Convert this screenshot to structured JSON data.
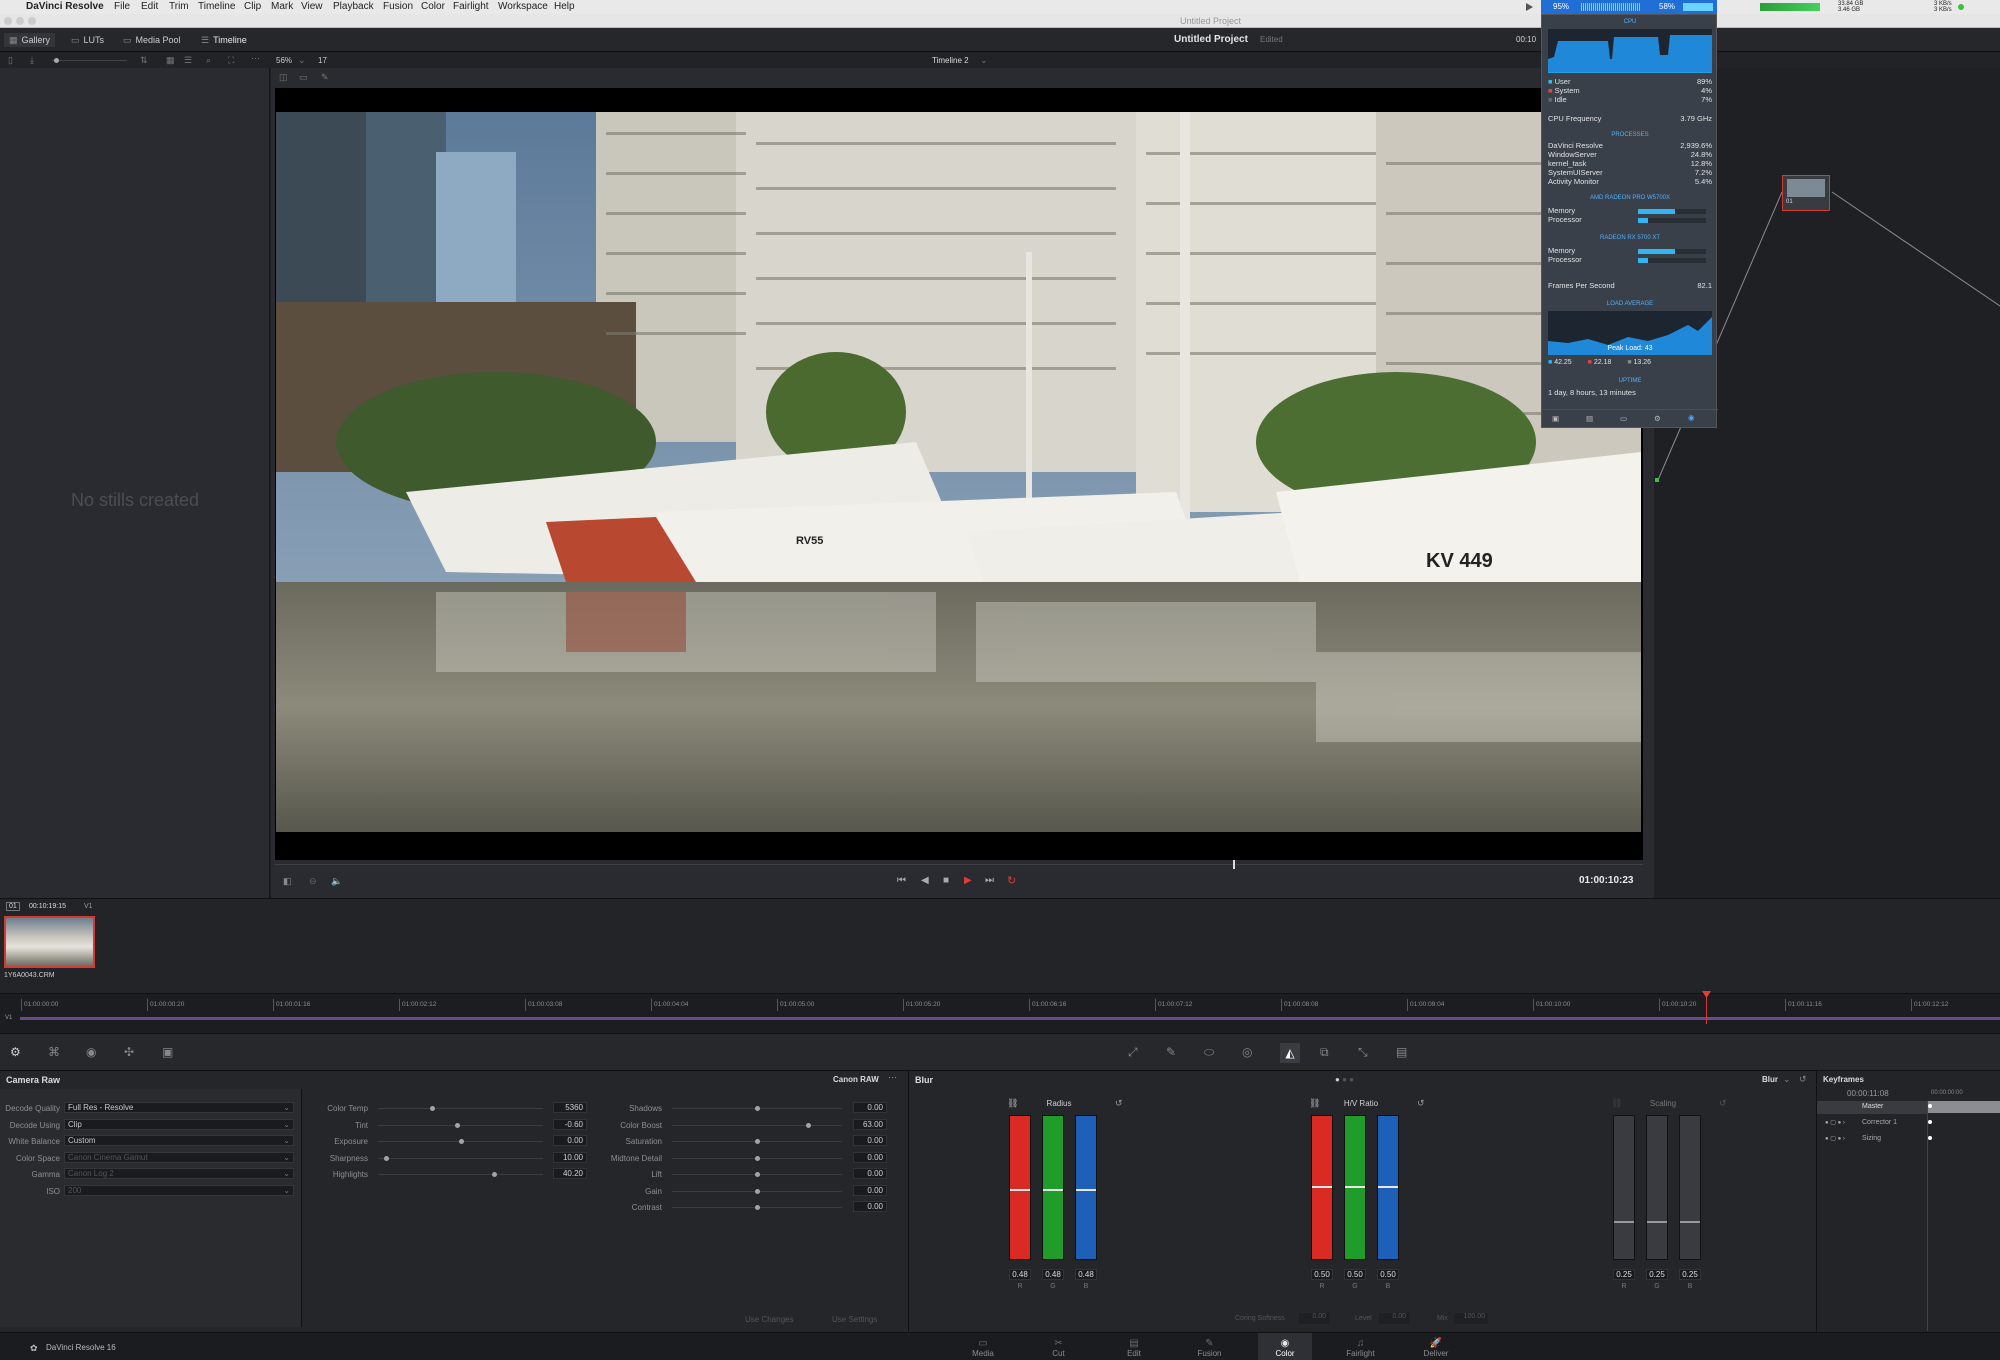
{
  "menubar": {
    "apple": "",
    "items": [
      "DaVinci Resolve",
      "File",
      "Edit",
      "Trim",
      "Timeline",
      "Clip",
      "Mark",
      "View",
      "Playback",
      "Fusion",
      "Color",
      "Fairlight",
      "Workspace",
      "Help"
    ],
    "status": {
      "cpu_pct": "95%",
      "gpu_pct": "58%",
      "net_up": "33.84 GB",
      "net_down": "3.46 GB",
      "rate_up": "3 KB/s",
      "rate_down": "3 KB/s"
    }
  },
  "window": {
    "title": "Untitled Project"
  },
  "pagebar": {
    "gallery": "Gallery",
    "luts": "LUTs",
    "media_pool": "Media Pool",
    "timeline": "Timeline",
    "project_title": "Untitled Project",
    "project_status": "Edited",
    "timecode_cut": "00:10"
  },
  "viewer": {
    "zoom": "56%",
    "frame_count": "17",
    "timeline_name": "Timeline 2",
    "timecode": "01:00:10:23",
    "image_label_a": "KV 449",
    "image_label_b": "RV55",
    "playhead_fraction": 0.7
  },
  "gallery": {
    "empty": "No stills created"
  },
  "clips": {
    "index": "01",
    "timecode": "00:10:19:15",
    "track": "V1",
    "clip_name": "1Y6A0043.CRM"
  },
  "ruler": {
    "track": "V1",
    "ticks": [
      "01:00:00:00",
      "01:00:00:20",
      "01:00:01:16",
      "01:00:02:12",
      "01:00:03:08",
      "01:00:04:04",
      "01:00:05:00",
      "01:00:05:20",
      "01:00:06:16",
      "01:00:07:12",
      "01:00:08:08",
      "01:00:09:04",
      "01:00:10:00",
      "01:00:10:20",
      "01:00:11:16",
      "01:00:12:12"
    ],
    "playhead_fraction": 0.853
  },
  "camera_raw": {
    "title": "Camera Raw",
    "codec": "Canon RAW",
    "left": [
      {
        "label": "Decode Quality",
        "value": "Full Res - Resolve",
        "disabled": false
      },
      {
        "label": "Decode Using",
        "value": "Clip",
        "disabled": false
      },
      {
        "label": "White Balance",
        "value": "Custom",
        "disabled": false
      },
      {
        "label": "Color Space",
        "value": "Canon Cinema Gamut",
        "disabled": true
      },
      {
        "label": "Gamma",
        "value": "Canon Log 2",
        "disabled": true
      },
      {
        "label": "ISO",
        "value": "200",
        "disabled": true
      }
    ],
    "mid": [
      {
        "label": "Color Temp",
        "value": "5360",
        "pos": 0.33
      },
      {
        "label": "Tint",
        "value": "-0.60",
        "pos": 0.48
      },
      {
        "label": "Exposure",
        "value": "0.00",
        "pos": 0.5
      },
      {
        "label": "Sharpness",
        "value": "10.00",
        "pos": 0.05
      },
      {
        "label": "Highlights",
        "value": "40.20",
        "pos": 0.7
      }
    ],
    "right": [
      {
        "label": "Shadows",
        "value": "0.00",
        "pos": 0.5
      },
      {
        "label": "Color Boost",
        "value": "63.00",
        "pos": 0.8
      },
      {
        "label": "Saturation",
        "value": "0.00",
        "pos": 0.5
      },
      {
        "label": "Midtone Detail",
        "value": "0.00",
        "pos": 0.5
      },
      {
        "label": "Lift",
        "value": "0.00",
        "pos": 0.5
      },
      {
        "label": "Gain",
        "value": "0.00",
        "pos": 0.5
      },
      {
        "label": "Contrast",
        "value": "0.00",
        "pos": 0.5
      }
    ],
    "use_changes": "Use Changes",
    "use_settings": "Use Settings"
  },
  "blur": {
    "title": "Blur",
    "mode": "Blur",
    "groups": [
      {
        "name": "Radius",
        "values": [
          "0.48",
          "0.48",
          "0.48"
        ],
        "level": 0.48,
        "enabled": true
      },
      {
        "name": "H/V Ratio",
        "values": [
          "0.50",
          "0.50",
          "0.50"
        ],
        "level": 0.5,
        "enabled": true
      },
      {
        "name": "Scaling",
        "values": [
          "0.25",
          "0.25",
          "0.25"
        ],
        "level": 0.25,
        "enabled": false
      }
    ],
    "channels": [
      "R",
      "G",
      "B"
    ],
    "coring_label": "Coring Softness",
    "coring_val": "0.00",
    "level_label": "Level",
    "level_val": "0.00",
    "mix_label": "Mix",
    "mix_val": "100.00"
  },
  "keyframes": {
    "title": "Keyframes",
    "timecode": "00:00:11:08",
    "timecode_b": "00:00:00:00",
    "rows": [
      "Master",
      "Corrector 1",
      "Sizing"
    ]
  },
  "footer": {
    "app": "DaVinci Resolve 16",
    "tabs": [
      "Media",
      "Cut",
      "Edit",
      "Fusion",
      "Color",
      "Fairlight",
      "Deliver"
    ],
    "active": "Color"
  },
  "stats": {
    "cpu_title": "CPU",
    "user": "89%",
    "system": "4%",
    "idle": "7%",
    "cpu_freq_label": "CPU Frequency",
    "cpu_freq": "3.79 GHz",
    "processes_title": "PROCESSES",
    "processes": [
      {
        "name": "DaVinci Resolve",
        "value": "2,939.6%"
      },
      {
        "name": "WindowServer",
        "value": "24.8%"
      },
      {
        "name": "kernel_task",
        "value": "12.8%"
      },
      {
        "name": "SystemUIServer",
        "value": "7.2%"
      },
      {
        "name": "Activity Monitor",
        "value": "5.4%"
      }
    ],
    "gpu1_title": "AMD RADEON PRO W5700X",
    "gpu1_memory": 0.55,
    "gpu1_processor": 0.15,
    "gpu2_title": "RADEON RX 5700 XT",
    "gpu2_memory": 0.55,
    "gpu2_processor": 0.15,
    "memory_label": "Memory",
    "processor_label": "Processor",
    "fps_label": "Frames Per Second",
    "fps": "82.1",
    "load_title": "LOAD AVERAGE",
    "peak": "Peak Load: 43",
    "load1": "42.25",
    "load5": "22.18",
    "load15": "13.26",
    "uptime_title": "UPTIME",
    "uptime": "1 day, 8 hours, 13 minutes",
    "user_label": "User",
    "system_label": "System",
    "idle_label": "Idle"
  },
  "colors": {
    "accent_red": "#d43a34",
    "accent_blue": "#33b5f2",
    "node_green": "#3fbf3f"
  }
}
